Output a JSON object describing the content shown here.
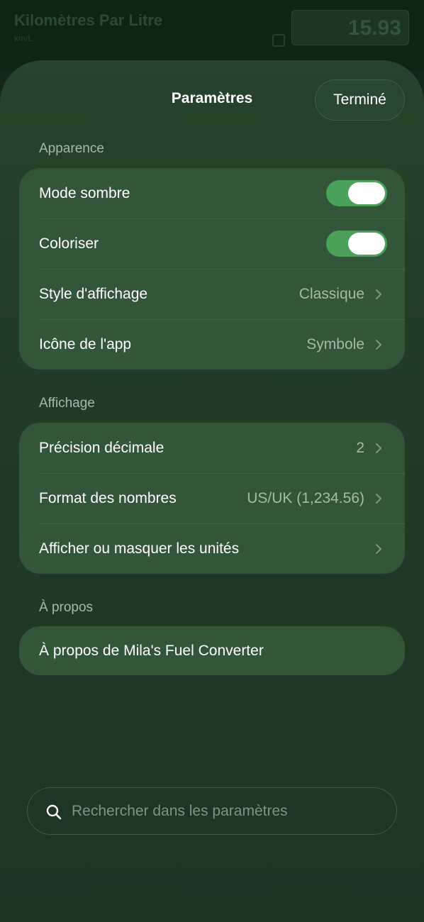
{
  "background": {
    "title": "Kilomètres Par Litre",
    "subtitle": "km/L",
    "value": "15.93"
  },
  "header": {
    "title": "Paramètres",
    "done_label": "Terminé"
  },
  "sections": {
    "appearance": {
      "header": "Apparence",
      "dark_mode": {
        "label": "Mode sombre",
        "on": true
      },
      "colorize": {
        "label": "Coloriser",
        "on": true
      },
      "display_style": {
        "label": "Style d'affichage",
        "value": "Classique"
      },
      "app_icon": {
        "label": "Icône de l'app",
        "value": "Symbole"
      }
    },
    "display": {
      "header": "Affichage",
      "decimal_precision": {
        "label": "Précision décimale",
        "value": "2"
      },
      "number_format": {
        "label": "Format des nombres",
        "value": "US/UK (1,234.56)"
      },
      "units": {
        "label": "Afficher ou masquer les unités"
      }
    },
    "about": {
      "header": "À propos",
      "about_app": {
        "label": "À propos de Mila's Fuel Converter"
      }
    }
  },
  "search": {
    "placeholder": "Rechercher dans les paramètres",
    "value": ""
  },
  "colors": {
    "toggle_on": "#4aa25a",
    "group_background": "#33563a",
    "sheet_background": "#27432c"
  },
  "icons": {
    "chevron": "chevron-right-icon",
    "search": "magnifying-glass-icon"
  }
}
